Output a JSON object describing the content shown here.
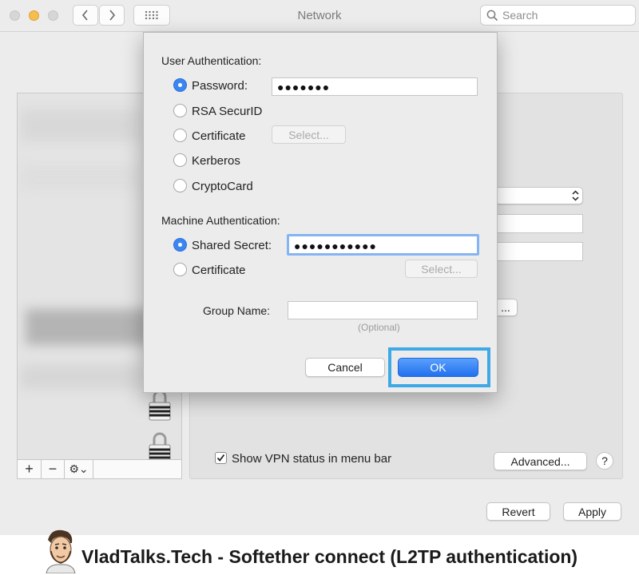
{
  "window": {
    "title": "Network"
  },
  "search": {
    "placeholder": "Search"
  },
  "toolbar": {
    "back_icon": "chevron-left-icon",
    "forward_icon": "chevron-right-icon",
    "grid_icon": "grid-icon"
  },
  "service_list": {
    "add": "+",
    "remove": "−",
    "gear": "⚙⌄"
  },
  "dialog": {
    "user_auth_heading": "User Authentication:",
    "user_options": [
      {
        "label": "Password:",
        "selected": true
      },
      {
        "label": "RSA SecurID",
        "selected": false
      },
      {
        "label": "Certificate",
        "selected": false
      },
      {
        "label": "Kerberos",
        "selected": false
      },
      {
        "label": "CryptoCard",
        "selected": false
      }
    ],
    "password_value": "●●●●●●●",
    "select_label": "Select...",
    "machine_auth_heading": "Machine Authentication:",
    "machine_options": [
      {
        "label": "Shared Secret:",
        "selected": true
      },
      {
        "label": "Certificate",
        "selected": false
      }
    ],
    "shared_secret_value": "●●●●●●●●●●●",
    "group_name_label": "Group Name:",
    "group_name_value": "",
    "group_name_hint": "(Optional)",
    "cancel_label": "Cancel",
    "ok_label": "OK"
  },
  "panel": {
    "show_vpn_label": "Show VPN status in menu bar",
    "show_vpn_checked": true,
    "advanced_label": "Advanced...",
    "help_label": "?",
    "partial_button": "..."
  },
  "footer": {
    "revert_label": "Revert",
    "apply_label": "Apply"
  },
  "banner": {
    "text": "VladTalks.Tech - Softether connect (L2TP authentication)"
  },
  "colors": {
    "accent": "#3a86f3",
    "highlight_border": "#3fa9e6"
  }
}
